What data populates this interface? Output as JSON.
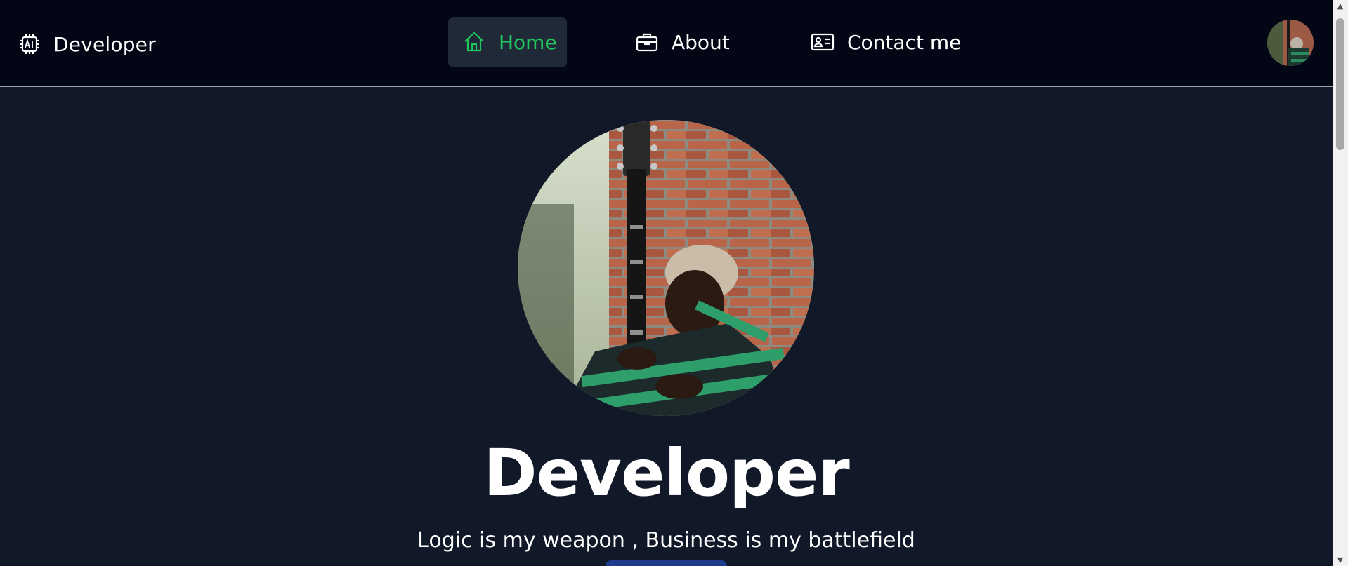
{
  "navbar": {
    "brand": {
      "icon": "ai-chip-icon",
      "label": "Developer"
    },
    "items": [
      {
        "label": "Home",
        "icon": "home-icon",
        "active": true
      },
      {
        "label": "About",
        "icon": "briefcase-icon",
        "active": false
      },
      {
        "label": "Contact me",
        "icon": "contact-card-icon",
        "active": false
      }
    ],
    "avatar": {
      "icon": "profile-avatar"
    }
  },
  "hero": {
    "title": "Developer",
    "subtitle": "Logic is my weapon , Business is my battlefield"
  },
  "colors": {
    "page_background": "#111827",
    "navbar_background": "#030615",
    "active_nav_background": "#1f2937",
    "accent": "#22c55e",
    "text": "#ffffff",
    "button": "#1e3a8a"
  }
}
